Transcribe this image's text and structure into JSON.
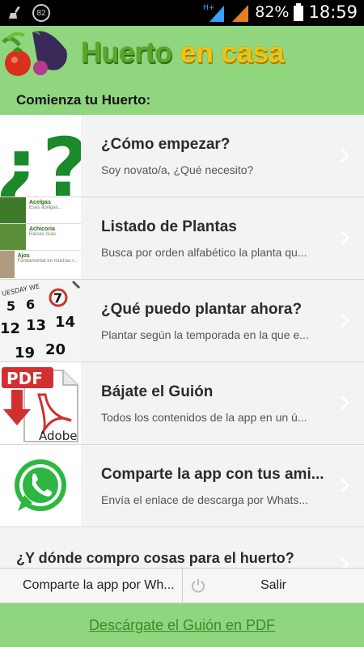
{
  "status_bar": {
    "notification_count": "82",
    "network": "H+",
    "battery_percent": "82%",
    "time": "18:59"
  },
  "header": {
    "title_part1": "Huerto ",
    "title_part2": "en casa",
    "accent_color": "#f1c40f",
    "brand_color": "#5aa62b"
  },
  "section_title": "Comienza tu Huerto:",
  "menu": [
    {
      "title": "¿Cómo empezar?",
      "subtitle": "Soy novato/a, ¿Qué necesito?",
      "icon": "question-marks-icon"
    },
    {
      "title": "Listado de Plantas",
      "subtitle": "Busca por orden alfabético la planta qu...",
      "icon": "plant-list-thumbnail",
      "thumb_rows": [
        {
          "name": "Acelgas",
          "desc": "Esas acelgas..."
        },
        {
          "name": "Achicoria",
          "desc": "Raíces ricas"
        },
        {
          "name": "Ajos",
          "desc": "Fundamental en muchas r..."
        }
      ]
    },
    {
      "title": "¿Qué puedo plantar ahora?",
      "subtitle": "Plantar según la temporada en la que e...",
      "icon": "calendar-icon",
      "calendar_header": "UESDAY WE"
    },
    {
      "title": "Bájate el Guión",
      "subtitle": "Todos los contenidos de la app en un ú...",
      "icon": "pdf-download-icon",
      "pdf_label": "PDF",
      "pdf_brand": "Adobe"
    },
    {
      "title": "Comparte la app con tus ami...",
      "subtitle": "Envía el enlace de descarga por Whats...",
      "icon": "whatsapp-icon"
    }
  ],
  "teaser": "¿Y dónde compro cosas para el huerto?",
  "action_bar": {
    "share_label": "Comparte la app por Wh...",
    "exit_label": "Salir"
  },
  "footer_link": "Descárgate el Guión en PDF"
}
